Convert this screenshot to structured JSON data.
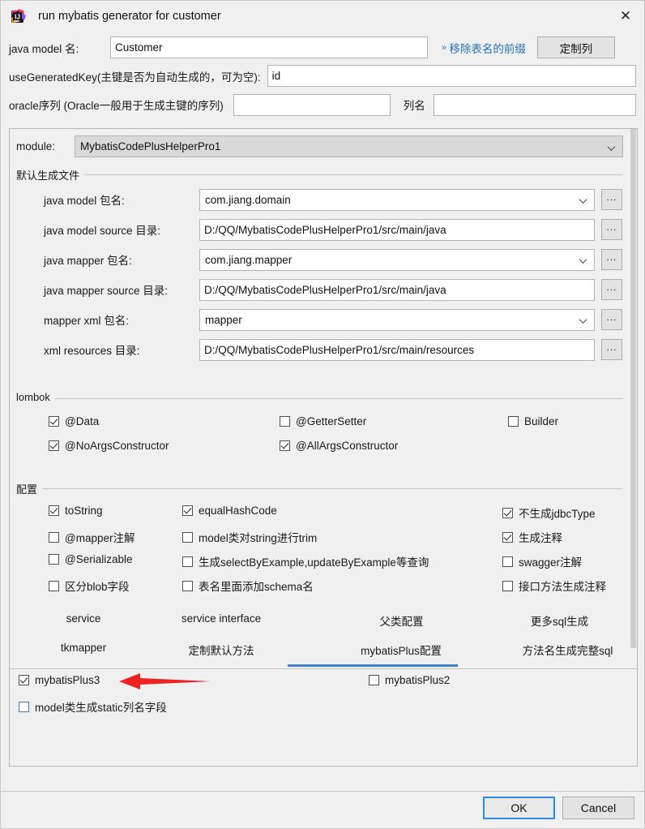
{
  "window": {
    "title": "run mybatis generator for customer",
    "app_icon": "intellij-idea-icon",
    "close_icon": "✕"
  },
  "top_form": {
    "java_model_label": "java model 名:",
    "java_model_value": "Customer",
    "remove_prefix_link": "移除表名的前缀",
    "remove_prefix_chevron": "››",
    "custom_column_button": "定制列",
    "use_generated_key_label": "useGeneratedKey(主键是否为自动生成的，可为空):",
    "use_generated_key_value": "id",
    "oracle_seq_label": "oracle序列 (Oracle一般用于生成主键的序列)",
    "oracle_seq_value": "",
    "column_name_label": "列名",
    "column_name_value": ""
  },
  "module": {
    "label": "module:",
    "value": "MybatisCodePlusHelperPro1"
  },
  "default_files": {
    "group_title": "默认生成文件",
    "browse_button": "...",
    "fields": [
      {
        "label": "java model 包名:",
        "value": "com.jiang.domain",
        "type": "combo"
      },
      {
        "label": "java model source 目录:",
        "value": "D:/QQ/MybatisCodePlusHelperPro1/src/main/java",
        "type": "text"
      },
      {
        "label": "java mapper 包名:",
        "value": "com.jiang.mapper",
        "type": "combo"
      },
      {
        "label": "java mapper source 目录:",
        "value": "D:/QQ/MybatisCodePlusHelperPro1/src/main/java",
        "type": "text"
      },
      {
        "label": "mapper xml 包名:",
        "value": "mapper",
        "type": "combo"
      },
      {
        "label": "xml resources 目录:",
        "value": "D:/QQ/MybatisCodePlusHelperPro1/src/main/resources",
        "type": "text"
      }
    ]
  },
  "lombok": {
    "group_title": "lombok",
    "items": [
      {
        "label": "@Data",
        "checked": true
      },
      {
        "label": "@GetterSetter",
        "checked": false
      },
      {
        "label": "Builder",
        "checked": false
      },
      {
        "label": "@NoArgsConstructor",
        "checked": true
      },
      {
        "label": "@AllArgsConstructor",
        "checked": true
      }
    ]
  },
  "config": {
    "group_title": "配置",
    "col1": [
      {
        "label": "toString",
        "checked": true
      },
      {
        "label": "@mapper注解",
        "checked": false
      },
      {
        "label": "@Serializable",
        "checked": false
      },
      {
        "label": "区分blob字段",
        "checked": false
      }
    ],
    "col2": [
      {
        "label": "equalHashCode",
        "checked": true
      },
      {
        "label": "model类对string进行trim",
        "checked": false
      },
      {
        "label": "生成selectByExample,updateByExample等查询",
        "checked": false
      },
      {
        "label": "表名里面添加schema名",
        "checked": false
      }
    ],
    "col3": [
      {
        "label": "不生成jdbcType",
        "checked": true
      },
      {
        "label": "生成注释",
        "checked": true
      },
      {
        "label": "swagger注解",
        "checked": false
      },
      {
        "label": "接口方法生成注释",
        "checked": false
      }
    ]
  },
  "tabs": {
    "row1": [
      {
        "label": "service",
        "active": false
      },
      {
        "label": "service interface",
        "active": false
      },
      {
        "label": "父类配置",
        "active": false
      },
      {
        "label": "更多sql生成",
        "active": false
      }
    ],
    "row2": [
      {
        "label": "tkmapper",
        "active": false
      },
      {
        "label": "定制默认方法",
        "active": false
      },
      {
        "label": "mybatisPlus配置",
        "active": true
      },
      {
        "label": "方法名生成完整sql",
        "active": false
      }
    ],
    "active_color": "#3d82c8"
  },
  "tab_content": {
    "items": [
      {
        "label": "mybatisPlus3",
        "checked": true,
        "focused": false
      },
      {
        "label": "mybatisPlus2",
        "checked": false,
        "focused": false
      },
      {
        "label": "model类生成static列名字段",
        "checked": false,
        "focused": true
      }
    ],
    "annotation_color": "#ee2222"
  },
  "footer": {
    "ok_label": "OK",
    "cancel_label": "Cancel"
  }
}
